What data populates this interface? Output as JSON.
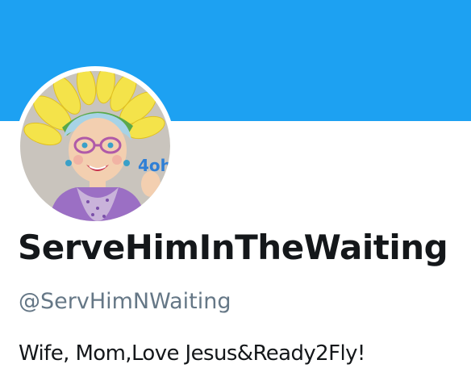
{
  "colors": {
    "banner": "#1da1f2",
    "name": "#14171a",
    "handle": "#657786"
  },
  "profile": {
    "display_name": "ServeHimInTheWaiting",
    "handle": "@ServHimNWaiting",
    "bio": "Wife, Mom,Love Jesus&Ready2Fly!",
    "avatar_text": "4oh"
  }
}
